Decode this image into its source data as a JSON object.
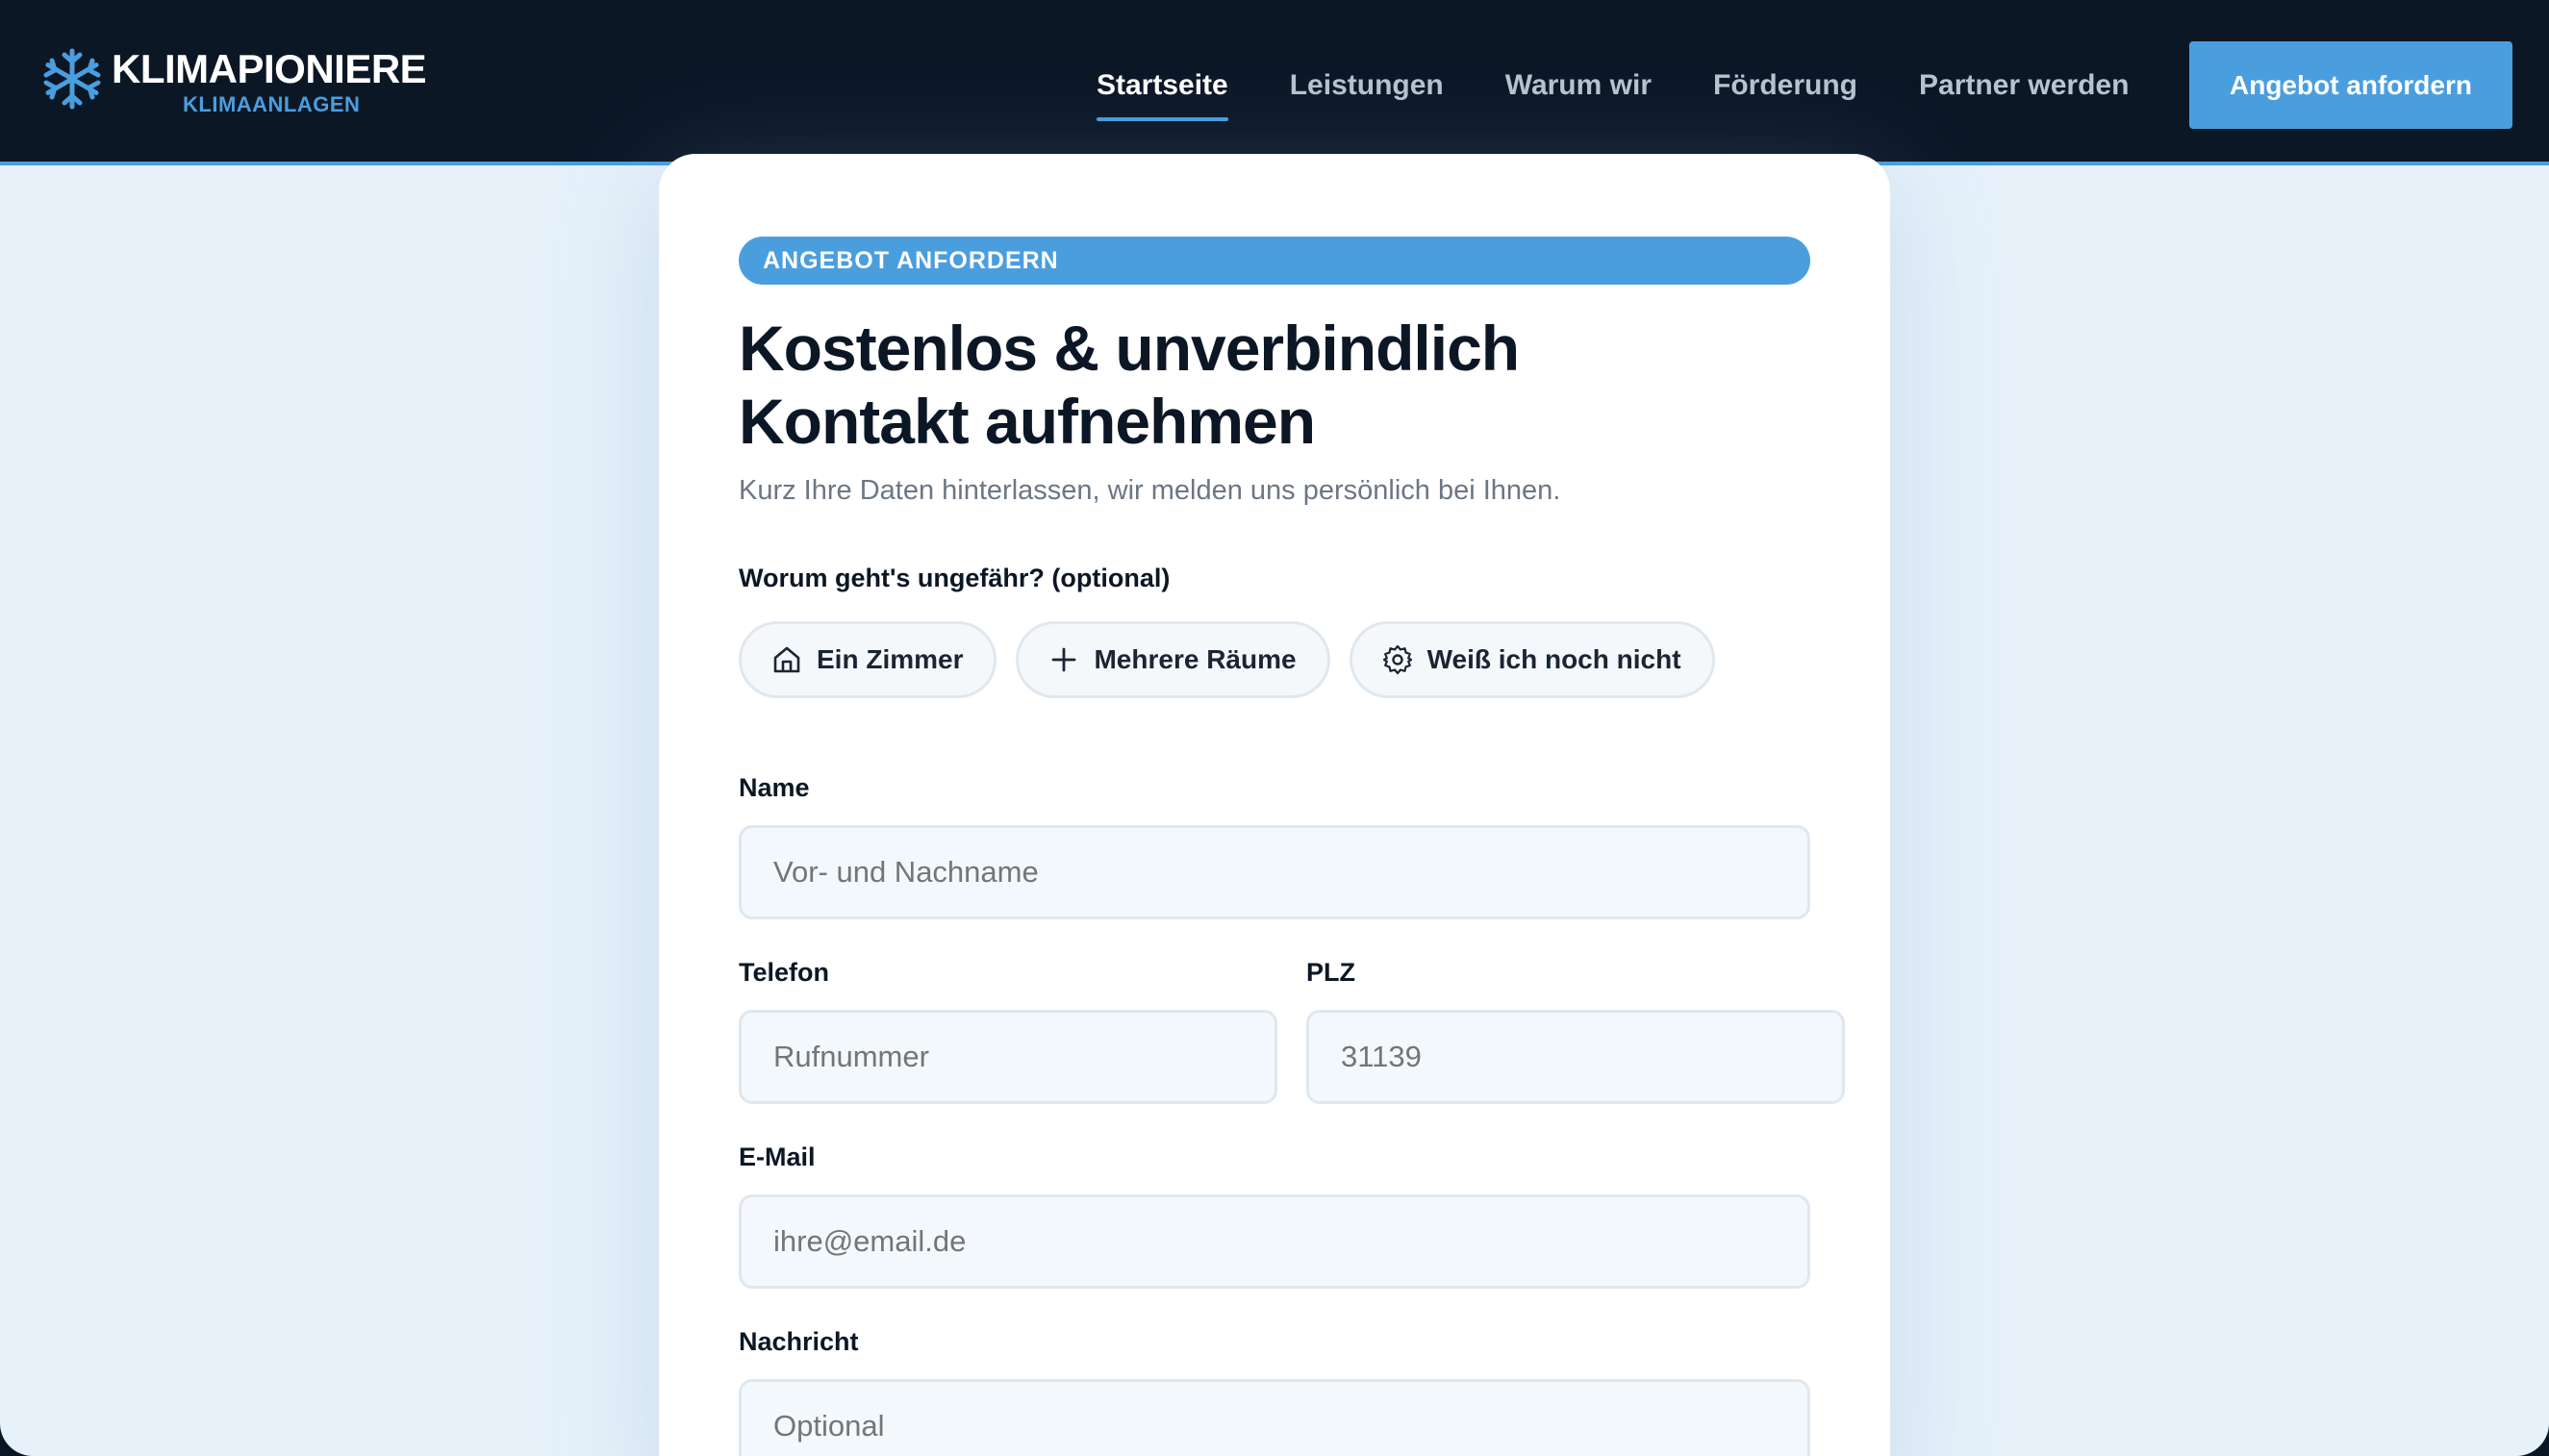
{
  "header": {
    "logo_main": "KLIMAPIONIERE",
    "logo_sub": "KLIMAANLAGEN",
    "nav": [
      {
        "label": "Startseite",
        "active": true
      },
      {
        "label": "Leistungen",
        "active": false
      },
      {
        "label": "Warum wir",
        "active": false
      },
      {
        "label": "Förderung",
        "active": false
      },
      {
        "label": "Partner werden",
        "active": false
      }
    ],
    "cta_label": "Angebot anfordern"
  },
  "form": {
    "badge": "ANGEBOT ANFORDERN",
    "title_line1": "Kostenlos & unverbindlich",
    "title_line2": "Kontakt aufnehmen",
    "subtitle": "Kurz Ihre Daten hinterlassen, wir melden uns persönlich bei Ihnen.",
    "question": "Worum geht's ungefähr? (optional)",
    "chips": [
      {
        "label": "Ein Zimmer",
        "icon": "house-icon"
      },
      {
        "label": "Mehrere Räume",
        "icon": "plus-icon"
      },
      {
        "label": "Weiß ich noch nicht",
        "icon": "gear-icon"
      }
    ],
    "name": {
      "label": "Name",
      "placeholder": "Vor- und Nachname",
      "value": ""
    },
    "phone": {
      "label": "Telefon",
      "placeholder": "Rufnummer",
      "value": ""
    },
    "zip": {
      "label": "PLZ",
      "placeholder": "31139",
      "value": ""
    },
    "email": {
      "label": "E-Mail",
      "placeholder": "ihre@email.de",
      "value": ""
    },
    "message": {
      "label": "Nachricht",
      "placeholder": "Optional",
      "value": ""
    }
  },
  "colors": {
    "accent": "#4a9ede",
    "header_bg": "#0c1726",
    "page_bg": "#e6f1fa"
  }
}
